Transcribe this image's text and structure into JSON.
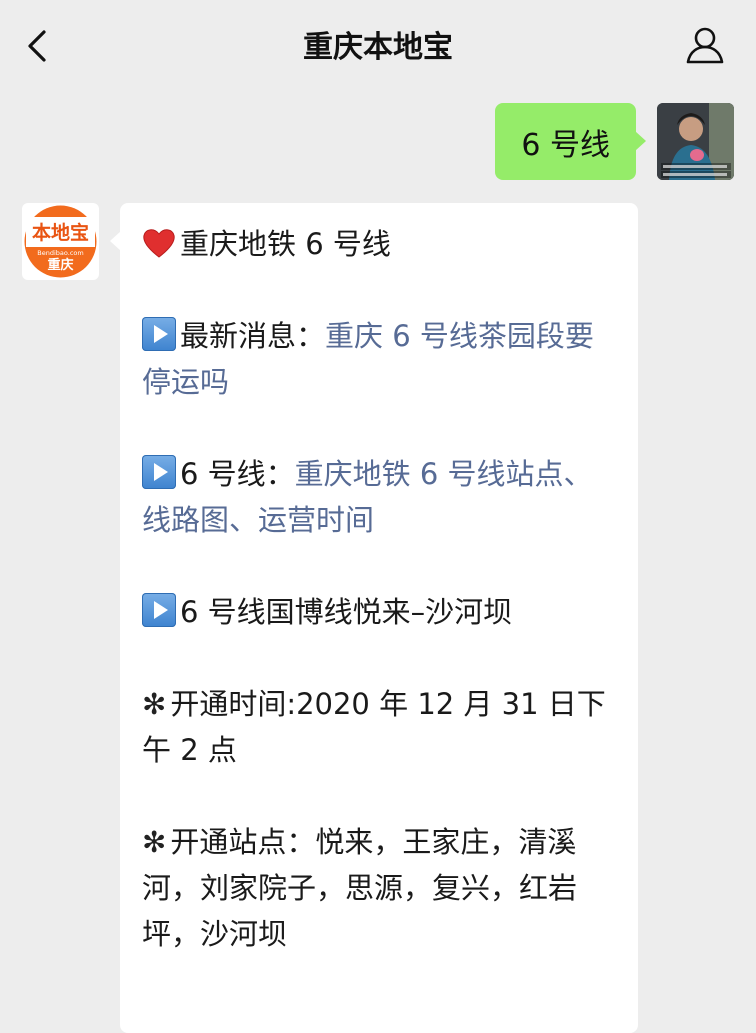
{
  "header": {
    "title": "重庆本地宝",
    "back_icon": "chevron-left-icon",
    "profile_icon": "person-icon"
  },
  "outgoing_message": {
    "text": "6 号线"
  },
  "incoming_message": {
    "sender_logo": {
      "top_text": "本地宝",
      "mid_text": "Bendibao.com",
      "bottom_text": "重庆"
    },
    "title": "重庆地铁 6 号线",
    "items": [
      {
        "label": "最新消息：",
        "link": "重庆 6 号线茶园段要停运吗"
      },
      {
        "label": "6 号线：",
        "link": "重庆地铁 6 号线站点、线路图、运营时间"
      },
      {
        "label": "6 号线国博线悦来–沙河坝",
        "link": ""
      }
    ],
    "open_time": "开通时间:2020 年 12 月 31 日下午 2 点",
    "open_stations": "开通站点：悦来，王家庄，清溪河，刘家院子，思源，复兴，红岩坪，沙河坝"
  },
  "colors": {
    "background": "#ededed",
    "outgoing_bubble": "#95ec69",
    "incoming_bubble": "#ffffff",
    "link": "#576b95",
    "logo_orange": "#f26b1d"
  }
}
